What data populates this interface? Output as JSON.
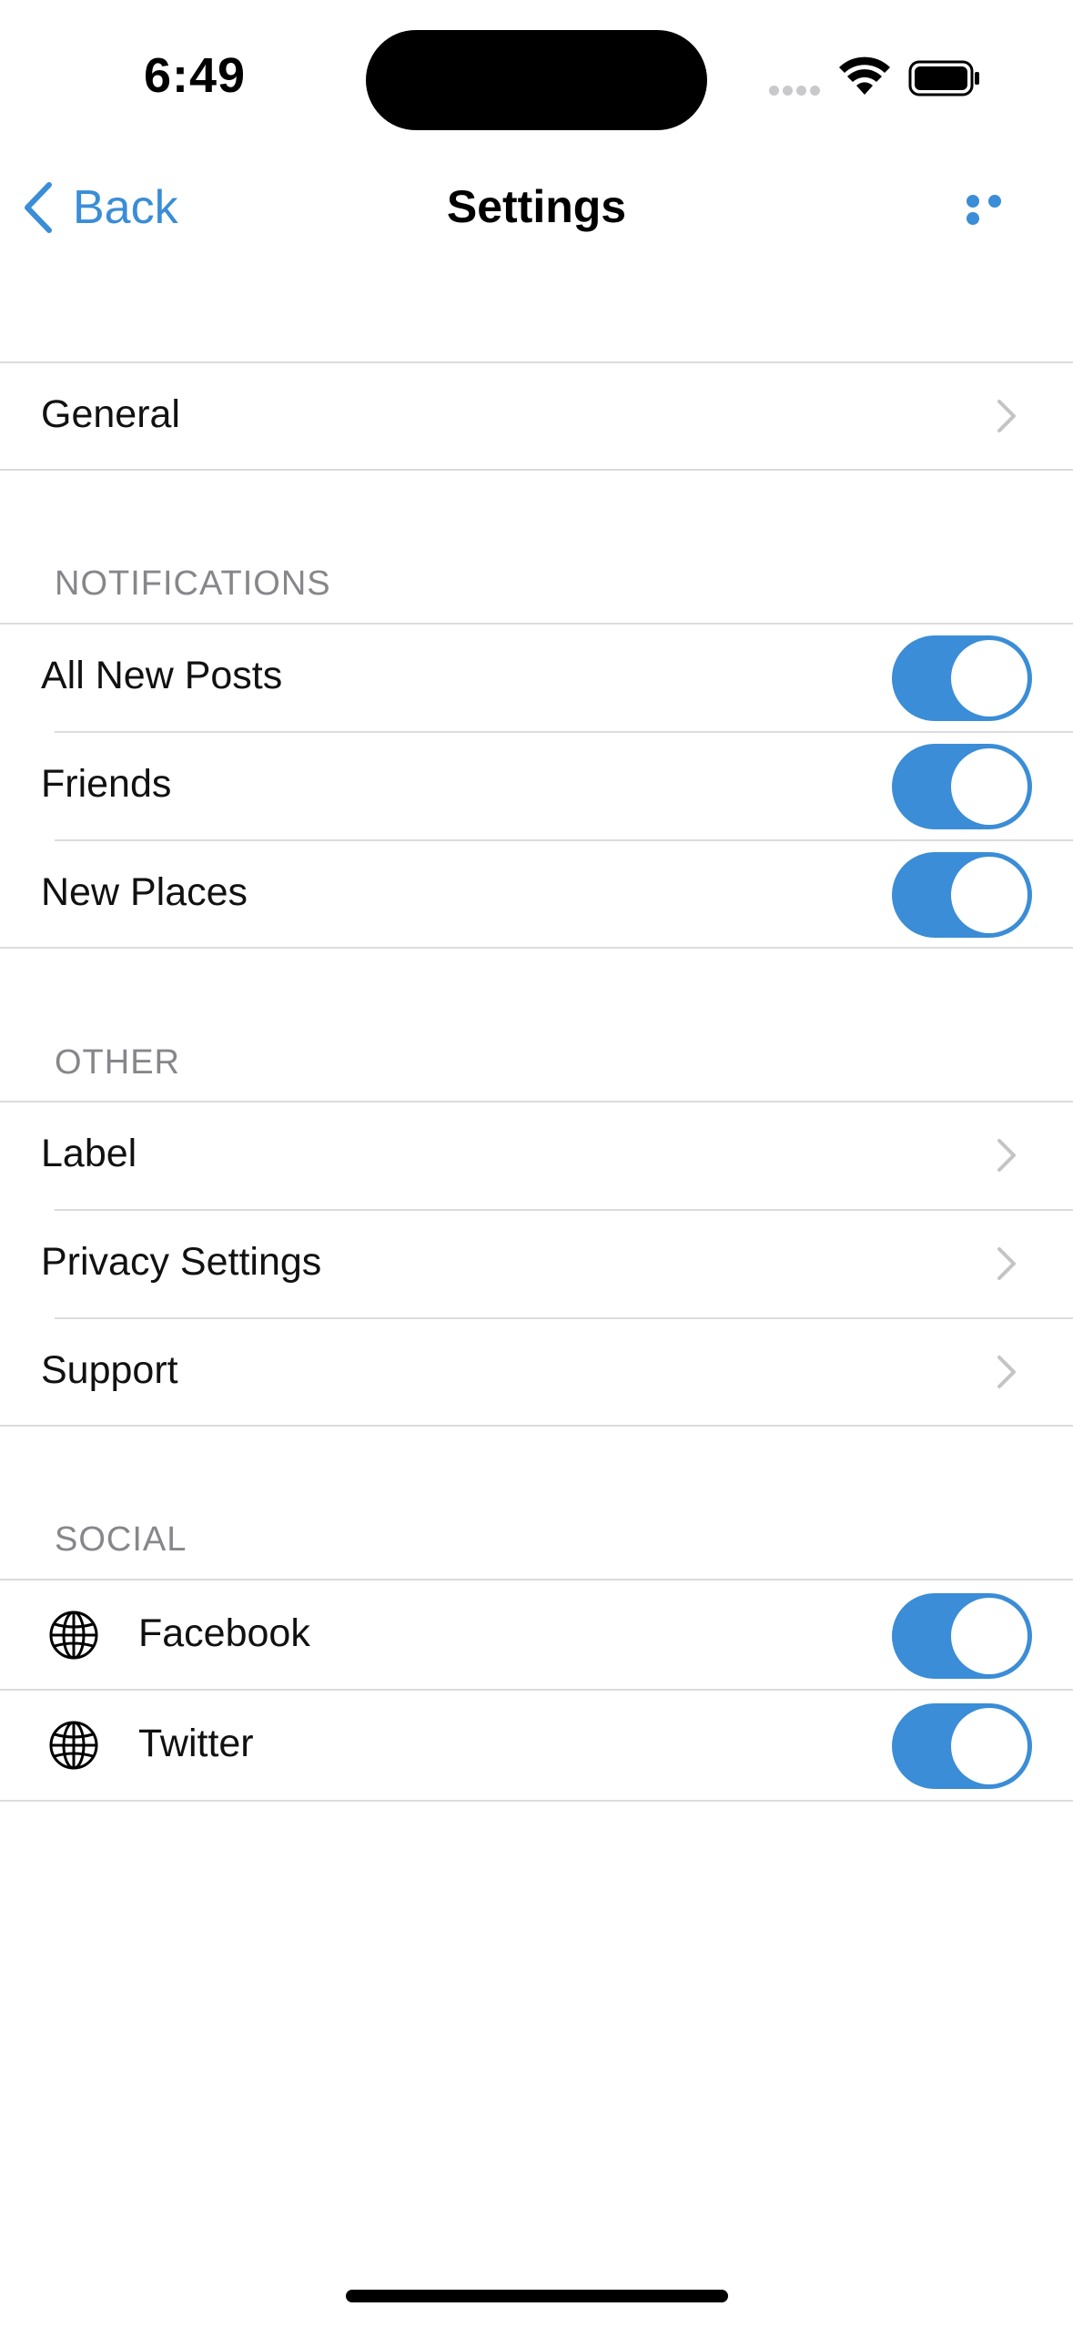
{
  "status_bar": {
    "time": "6:49"
  },
  "nav": {
    "back_label": "Back",
    "title": "Settings"
  },
  "sections": {
    "general": {
      "items": [
        {
          "label": "General",
          "accessory": "chevron"
        }
      ]
    },
    "notifications": {
      "header": "NOTIFICATIONS",
      "items": [
        {
          "label": "All New Posts",
          "toggle_on": true
        },
        {
          "label": "Friends",
          "toggle_on": true
        },
        {
          "label": "New Places",
          "toggle_on": true
        }
      ]
    },
    "other": {
      "header": "OTHER",
      "items": [
        {
          "label": "Label",
          "accessory": "chevron"
        },
        {
          "label": "Privacy Settings",
          "accessory": "chevron"
        },
        {
          "label": "Support",
          "accessory": "chevron"
        }
      ]
    },
    "social": {
      "header": "SOCIAL",
      "items": [
        {
          "label": "Facebook",
          "icon": "globe-icon",
          "toggle_on": true
        },
        {
          "label": "Twitter",
          "icon": "globe-icon",
          "toggle_on": true
        }
      ]
    }
  },
  "colors": {
    "accent": "#3a8dd6",
    "separator": "#dcdcdf",
    "section_header": "#86868b",
    "chevron": "#c4c4c7"
  }
}
